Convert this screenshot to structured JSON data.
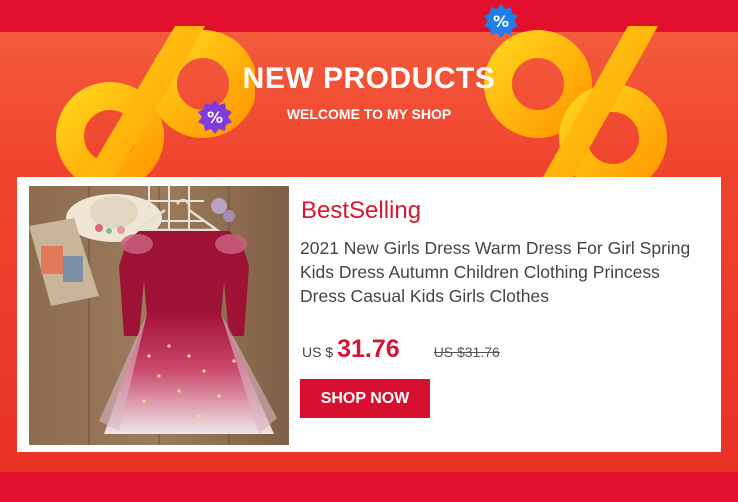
{
  "banner": {
    "title": "NEW PRODUCTS",
    "subtitle": "WELCOME TO MY SHOP",
    "badge_symbol": "%",
    "decoration_icon": "percent-icon"
  },
  "product": {
    "label": "BestSelling",
    "description": "2021 New Girls Dress Warm Dress For Girl Spring Kids Dress Autumn Children Clothing Princess Dress Casual Kids Girls Clothes",
    "currency": "US $",
    "price": "31.76",
    "old_price": "US $31.76",
    "button_label": "SHOP NOW",
    "image_icon": "dress-photo"
  },
  "colors": {
    "accent": "#d7102f",
    "banner": "#f0442f",
    "gold": "#ffb400"
  }
}
